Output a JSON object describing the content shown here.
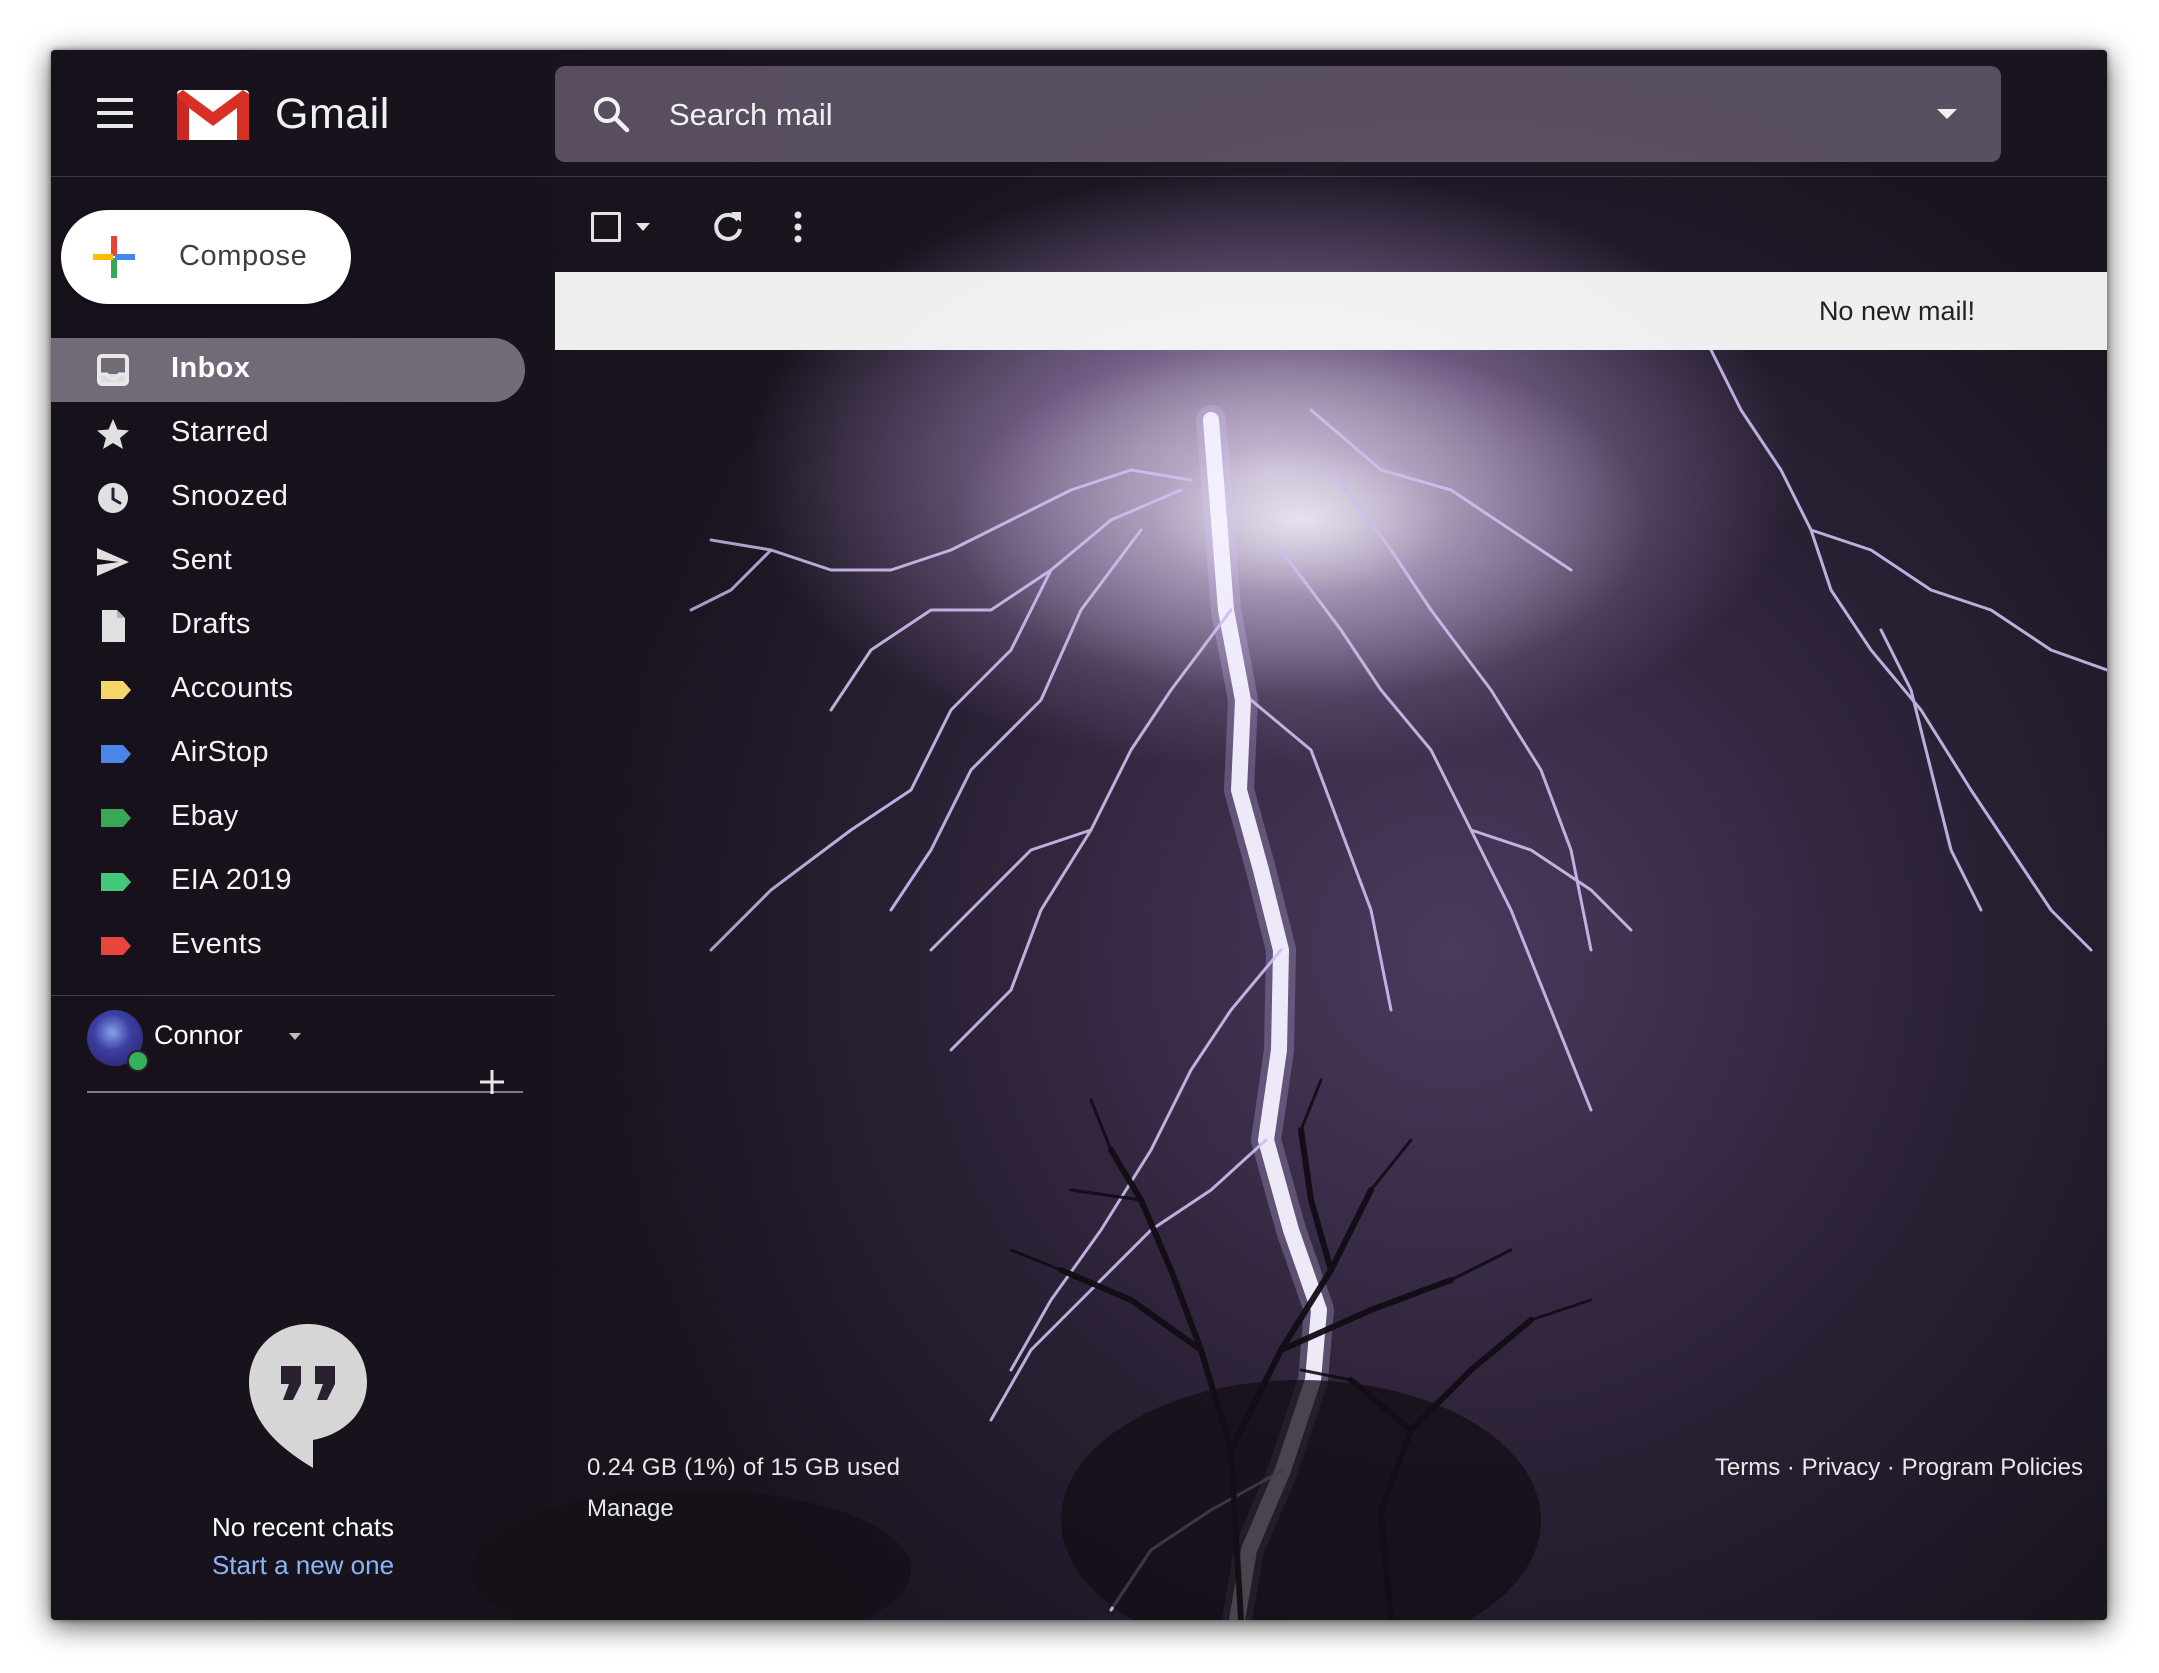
{
  "header": {
    "app_title": "Gmail",
    "menu_icon": "hamburger-menu-icon",
    "logo_icon": "gmail-logo-icon",
    "search": {
      "placeholder": "Search mail",
      "icon": "search-icon",
      "options_icon": "dropdown-caret-icon"
    }
  },
  "compose": {
    "label": "Compose",
    "icon": "plus-icon"
  },
  "sidebar": {
    "items": [
      {
        "label": "Inbox",
        "icon": "inbox-icon",
        "active": true
      },
      {
        "label": "Starred",
        "icon": "star-icon"
      },
      {
        "label": "Snoozed",
        "icon": "clock-icon"
      },
      {
        "label": "Sent",
        "icon": "send-icon"
      },
      {
        "label": "Drafts",
        "icon": "draft-icon"
      },
      {
        "label": "Accounts",
        "icon": "label-icon",
        "color": "#f6d66a"
      },
      {
        "label": "AirStop",
        "icon": "label-icon",
        "color": "#4a86e8"
      },
      {
        "label": "Ebay",
        "icon": "label-icon",
        "color": "#3aa757"
      },
      {
        "label": "EIA 2019",
        "icon": "label-icon",
        "color": "#43c87a"
      },
      {
        "label": "Events",
        "icon": "label-icon",
        "color": "#e8453c"
      }
    ]
  },
  "hangouts": {
    "user_name": "Connor",
    "status": "online",
    "status_color": "#35b159",
    "new_chat_icon": "plus-icon",
    "empty_icon": "quote-bubble-icon",
    "no_chats_text": "No recent chats",
    "start_chat_link": "Start a new one"
  },
  "toolbar": {
    "select_icon": "checkbox-icon",
    "refresh_icon": "refresh-icon",
    "more_icon": "more-vert-icon"
  },
  "mail_list": {
    "empty_message": "No new mail!"
  },
  "footer": {
    "storage": "0.24 GB (1%) of 15 GB used",
    "manage": "Manage",
    "terms": "Terms",
    "separator": " · ",
    "privacy": "Privacy",
    "program_policies": "Program Policies"
  },
  "theme": {
    "background": "lightning-storm-purple",
    "accent_blue": "#8ab4f8"
  }
}
